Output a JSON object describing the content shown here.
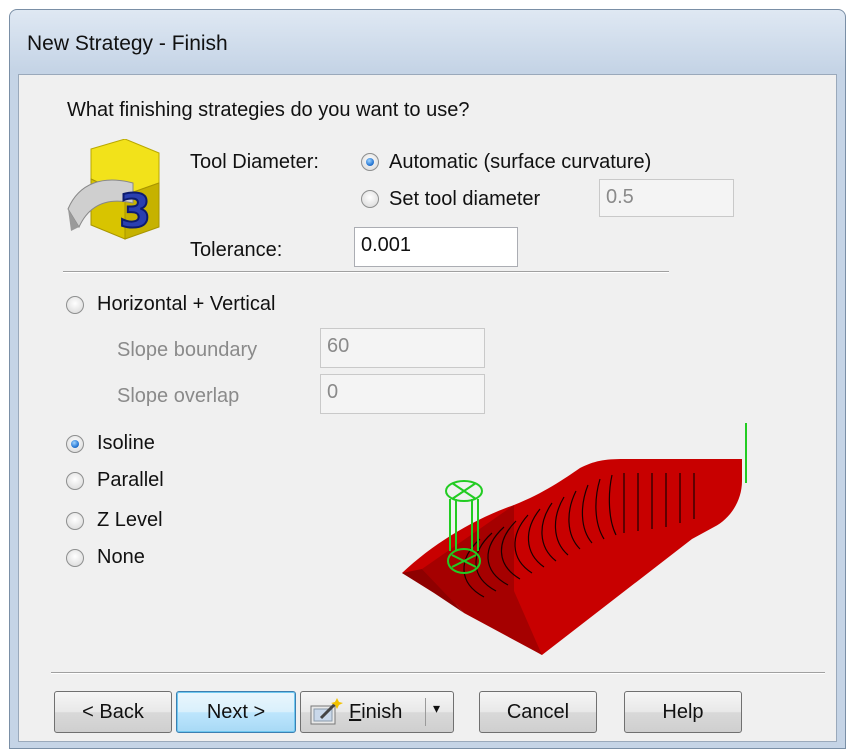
{
  "window": {
    "title": "New Strategy - Finish"
  },
  "prompt": "What finishing strategies do you want to use?",
  "tool_diameter": {
    "label": "Tool Diameter:",
    "options": [
      {
        "label": "Automatic (surface curvature)",
        "selected": true
      },
      {
        "label": "Set tool diameter",
        "selected": false
      }
    ],
    "value": "0.5"
  },
  "tolerance": {
    "label": "Tolerance:",
    "value": "0.001"
  },
  "strategies": {
    "horizontal_vertical": {
      "label": "Horizontal + Vertical",
      "selected": false
    },
    "slope_boundary": {
      "label": "Slope boundary",
      "value": "60"
    },
    "slope_overlap": {
      "label": "Slope overlap",
      "value": "0"
    },
    "isoline": {
      "label": "Isoline",
      "selected": true
    },
    "parallel": {
      "label": "Parallel",
      "selected": false
    },
    "z_level": {
      "label": "Z Level",
      "selected": false
    },
    "none": {
      "label": "None",
      "selected": false
    }
  },
  "buttons": {
    "back": "< Back",
    "next": "Next >",
    "finish_first": "F",
    "finish_rest": "inish",
    "cancel": "Cancel",
    "help": "Help"
  },
  "colors": {
    "preview_surface": "#cc0000",
    "tool": "#22cc22",
    "icon_badge": "#f2e21a",
    "radio_accent": "#2a7ad6"
  },
  "icons": {
    "logo": "3-axis-finish-icon",
    "finish": "finish-wand-icon",
    "dropdown": "chevron-down-icon"
  }
}
